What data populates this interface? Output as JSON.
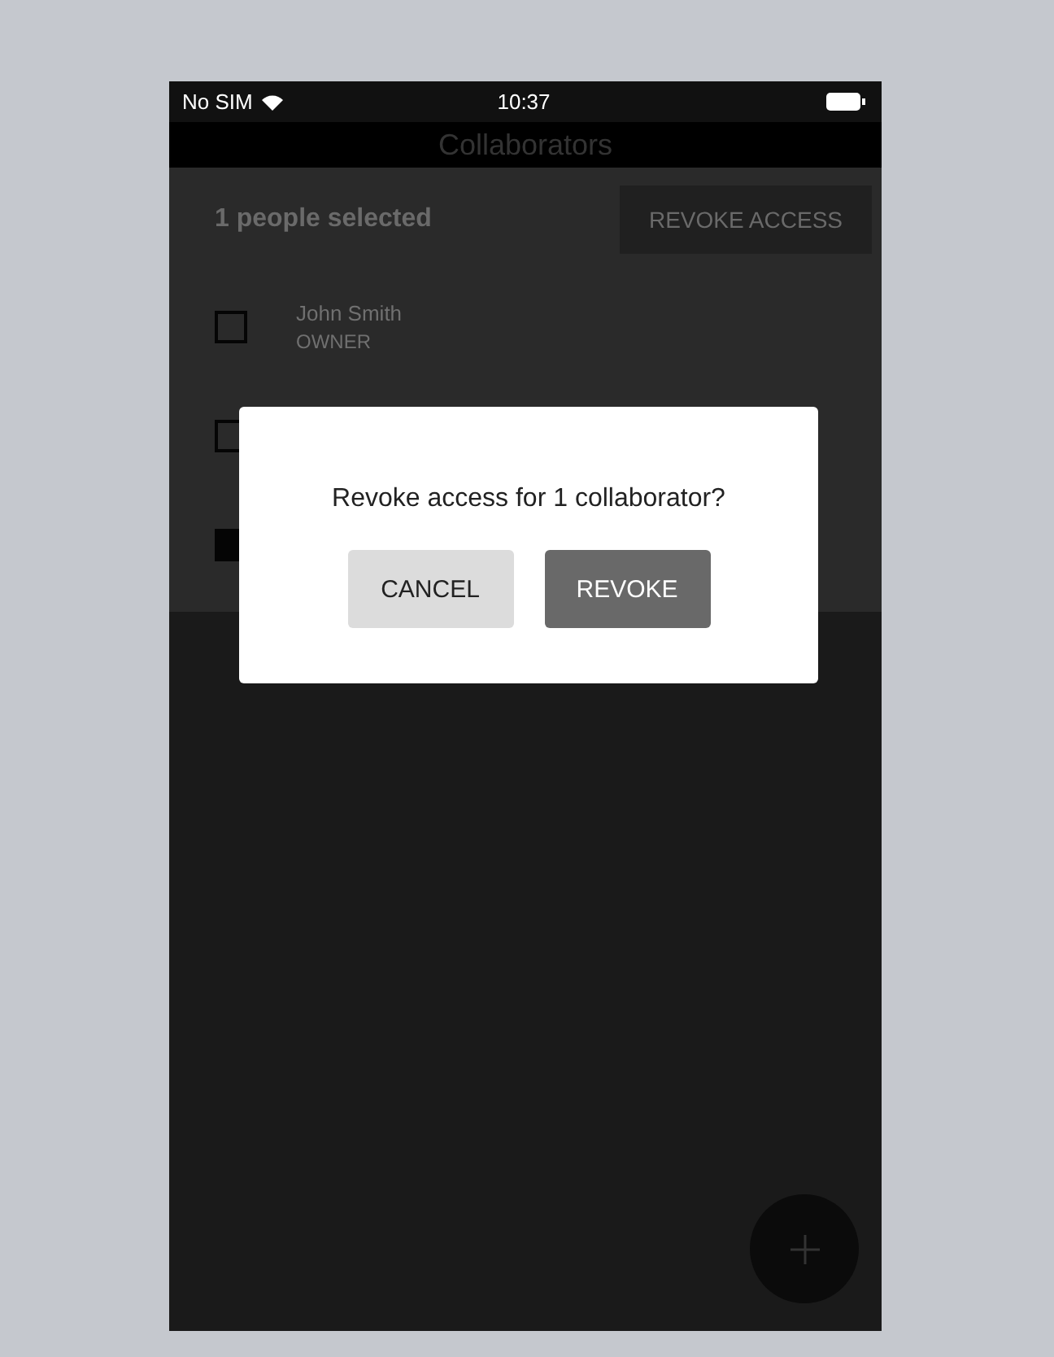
{
  "status_bar": {
    "carrier": "No SIM",
    "time": "10:37"
  },
  "header": {
    "title": "Collaborators"
  },
  "selection_bar": {
    "count_label": "1 people selected",
    "action": "REVOKE ACCESS"
  },
  "collaborators": [
    {
      "name": "John Smith",
      "role": "OWNER",
      "checked": false
    },
    {
      "checked": false
    },
    {
      "checked": true
    }
  ],
  "dialog": {
    "message": "Revoke access for 1 collaborator?",
    "buttons": [
      {
        "label": "CANCEL",
        "kind": "secondary"
      },
      {
        "label": "REVOKE",
        "kind": "primary"
      }
    ]
  }
}
